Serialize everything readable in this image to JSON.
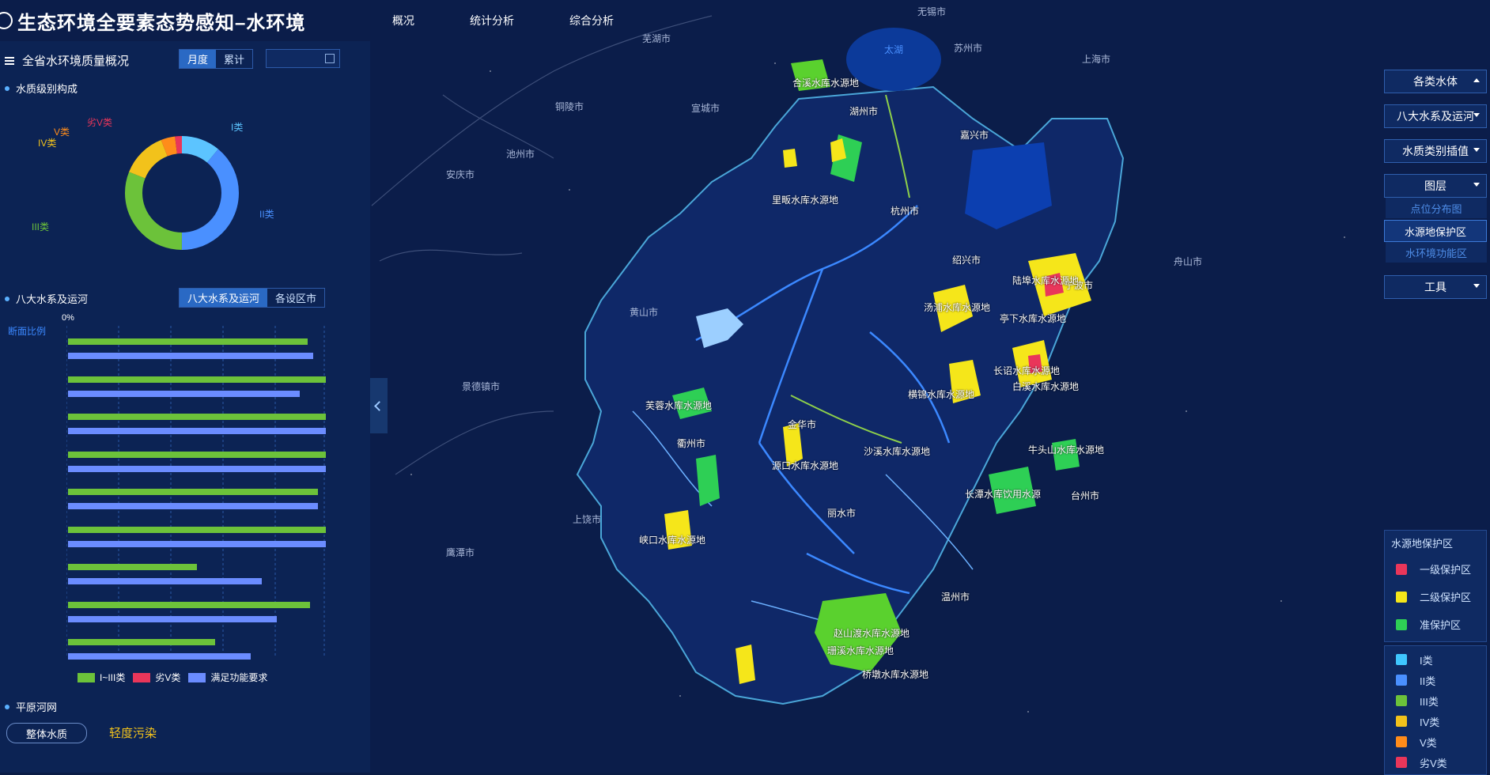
{
  "app": {
    "title": "生态环境全要素态势感知–水环境"
  },
  "nav": {
    "tabs": [
      "概况",
      "统计分析",
      "综合分析"
    ]
  },
  "left": {
    "section1_title": "全省水环境质量概况",
    "period_tabs": [
      "月度",
      "累计"
    ],
    "quality_title": "水质级别构成",
    "donut": {
      "labels": {
        "c1": "I类",
        "c2": "II类",
        "c3": "III类",
        "c4": "IV类",
        "c5": "V类",
        "c6": "劣V类"
      },
      "values": [
        {
          "name": "I类",
          "share": 0.11
        },
        {
          "name": "II类",
          "share": 0.39
        },
        {
          "name": "III类",
          "share": 0.31
        },
        {
          "name": "IV类",
          "share": 0.13
        },
        {
          "name": "V类",
          "share": 0.04
        },
        {
          "name": "劣V类",
          "share": 0.02
        }
      ],
      "colors": [
        "#5cc4ff",
        "#4a90ff",
        "#6cc23a",
        "#f2c21b",
        "#ff8c1a",
        "#e9365a"
      ]
    },
    "section2_title": "八大水系及运河",
    "section2_tabs": [
      "八大水系及运河",
      "各设区市"
    ],
    "axis_start": "0%",
    "y_caption": "断面比例",
    "legend": [
      "I~III类",
      "劣V类",
      "满足功能要求"
    ],
    "section3_title": "平原河网",
    "overall_btn": "整体水质",
    "overall_value": "轻度污染"
  },
  "chart_data": {
    "type": "bar",
    "orientation": "horizontal",
    "series": [
      {
        "name": "I~III类",
        "color": "#6cc23a",
        "values": [
          93,
          100,
          100,
          100,
          97,
          100,
          50,
          94,
          57
        ]
      },
      {
        "name": "满足功能要求",
        "color": "#6b8cff",
        "values": [
          95,
          90,
          100,
          100,
          97,
          100,
          75,
          81,
          71
        ]
      }
    ],
    "xlim": [
      0,
      100
    ]
  },
  "right": {
    "btn_water": "各类水体",
    "btn_system": "八大水系及运河",
    "btn_interp": "水质类别插值",
    "btn_layer": "图层",
    "layer_items": [
      "点位分布图",
      "水源地保护区",
      "水环境功能区"
    ],
    "btn_tools": "工具",
    "zone_title": "水源地保护区",
    "zones": [
      {
        "label": "一级保护区",
        "color": "#e9365a"
      },
      {
        "label": "二级保护区",
        "color": "#f5e61a"
      },
      {
        "label": "准保护区",
        "color": "#2ecf55"
      }
    ],
    "classes": [
      {
        "label": "I类",
        "color": "#3fc7ff"
      },
      {
        "label": "II类",
        "color": "#4a90ff"
      },
      {
        "label": "III类",
        "color": "#6cc23a"
      },
      {
        "label": "IV类",
        "color": "#f2c21b"
      },
      {
        "label": "V类",
        "color": "#ff8c1a"
      },
      {
        "label": "劣V类",
        "color": "#e9365a"
      }
    ]
  },
  "map": {
    "cities": [
      "无锡市",
      "芜湖市",
      "苏州市",
      "上海市",
      "铜陵市",
      "宣城市",
      "池州市",
      "安庆市",
      "黄山市",
      "景德镇市",
      "上饶市",
      "鹰潭市",
      "舟山市"
    ],
    "lake": "太湖",
    "places": [
      "湖州市",
      "嘉兴市",
      "杭州市",
      "绍兴市",
      "宁波市",
      "金华市",
      "衢州市",
      "丽水市",
      "台州市",
      "温州市"
    ],
    "sources": [
      "合溪水库水源地",
      "里畈水库水源地",
      "汤浦水库水源地",
      "亭下水库水源地",
      "陆埠水库水源地",
      "长诏水库水源地",
      "白溪水库水源地",
      "横锦水库水源地",
      "芙蓉水库水源地",
      "沙溪水库水源地",
      "源口水库水源地",
      "牛头山水库水源地",
      "长潭水库饮用水源",
      "峡口水库水源地",
      "赵山渡水库水源地",
      "珊溪水库水源地",
      "桥墩水库水源地"
    ]
  }
}
